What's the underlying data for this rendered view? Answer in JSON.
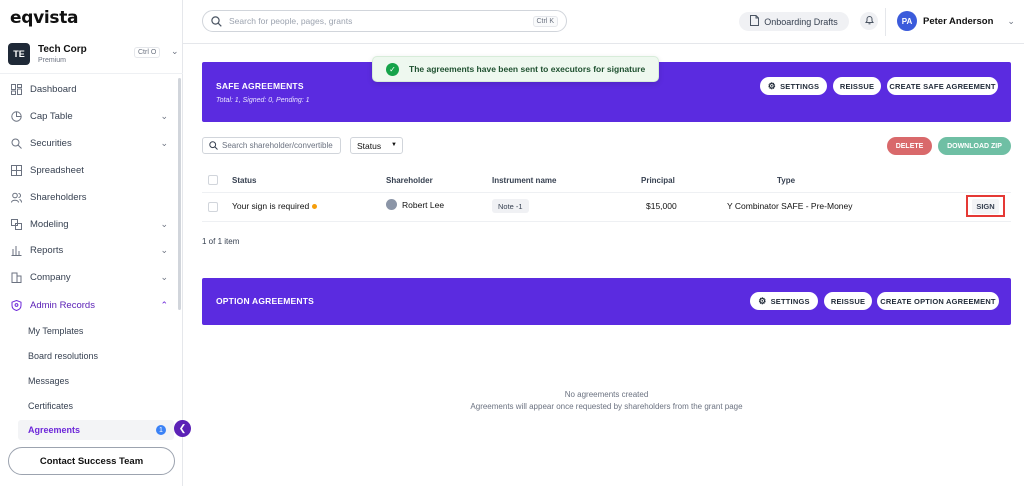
{
  "app": {
    "logo": "eqvista"
  },
  "company": {
    "initials": "TE",
    "name": "Tech Corp",
    "plan": "Premium",
    "shortcut": "Ctrl O"
  },
  "sidebar": {
    "items": [
      {
        "label": "Dashboard",
        "icon": "dashboard-icon"
      },
      {
        "label": "Cap Table",
        "icon": "pie-chart-icon"
      },
      {
        "label": "Securities",
        "icon": "securities-icon"
      },
      {
        "label": "Spreadsheet",
        "icon": "grid-icon"
      },
      {
        "label": "Shareholders",
        "icon": "users-icon"
      },
      {
        "label": "Modeling",
        "icon": "modeling-icon"
      },
      {
        "label": "Reports",
        "icon": "reports-icon"
      },
      {
        "label": "Company",
        "icon": "company-icon"
      },
      {
        "label": "Admin Records",
        "icon": "shield-icon"
      }
    ],
    "subitems": [
      "My Templates",
      "Board resolutions",
      "Messages",
      "Certificates",
      "Agreements"
    ],
    "agreements_badge": "1",
    "contact_label": "Contact Success Team"
  },
  "topbar": {
    "search_placeholder": "Search for people, pages, grants",
    "search_shortcut": "Ctrl K",
    "drafts_label": "Onboarding Drafts",
    "user_initials": "PA",
    "user_name": "Peter Anderson"
  },
  "toast": {
    "message": "The agreements have been sent to executors for signature"
  },
  "safe": {
    "title": "SAFE AGREEMENTS",
    "summary": "Total: 1, Signed: 0, Pending: 1",
    "settings_label": "SETTINGS",
    "reissue_label": "REISSUE",
    "create_label": "CREATE SAFE AGREEMENT"
  },
  "toolbar": {
    "search_placeholder": "Search shareholder/convertible",
    "status_label": "Status",
    "delete_label": "DELETE",
    "download_label": "DOWNLOAD ZIP"
  },
  "table": {
    "headers": {
      "status": "Status",
      "shareholder": "Shareholder",
      "instrument": "Instrument name",
      "principal": "Principal",
      "type": "Type"
    },
    "row": {
      "status": "Your sign is required",
      "shareholder": "Robert Lee",
      "instrument": "Note -1",
      "principal": "$15,000",
      "type": "Y Combinator SAFE - Pre-Money",
      "action": "SIGN"
    },
    "count": "1 of 1 item"
  },
  "option": {
    "title": "OPTION AGREEMENTS",
    "settings_label": "SETTINGS",
    "reissue_label": "REISSUE",
    "create_label": "CREATE OPTION AGREEMENT"
  },
  "empty": {
    "title": "No agreements created",
    "subtitle": "Agreements will appear once requested by shareholders from the grant page"
  },
  "colors": {
    "accent": "#5b2be0",
    "active": "#6d28d9",
    "delete": "#d9696b",
    "download": "#6fbfa4",
    "toast_bg": "#eef8ef",
    "success": "#16a34a"
  }
}
